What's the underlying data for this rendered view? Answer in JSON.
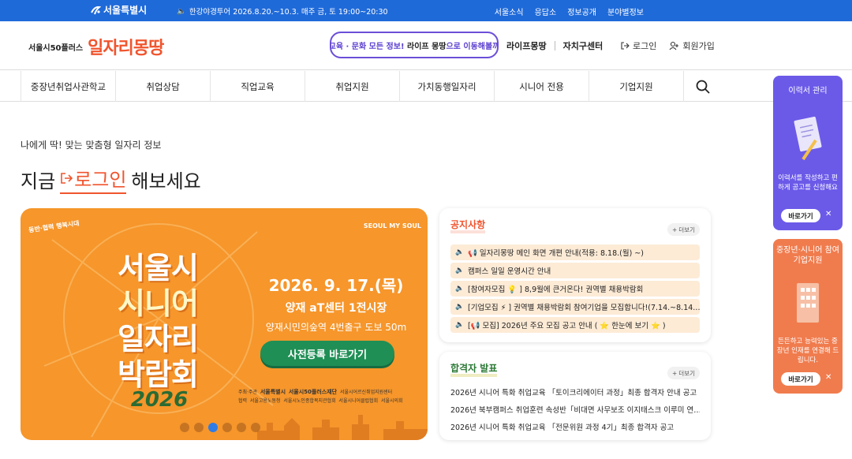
{
  "topbar": {
    "logo": "서울특별시",
    "notice": "한강야경투어 2026.8.20.~10.3. 매주 금, 토 19:00~20:30",
    "links": [
      "서울소식",
      "응답소",
      "정보공개",
      "분야별정보"
    ]
  },
  "header": {
    "brand_sub": "서울시50플러스",
    "brand_main": "일자리몽땅",
    "promo_a": "교육 · 문화 모든 정보!",
    "promo_b": "라이프 몽땅",
    "promo_c": "으로 이동해볼까",
    "nav": [
      "라이프몽땅",
      "자치구센터"
    ],
    "login": "로그인",
    "signup": "회원가입"
  },
  "gnb": [
    "중장년취업사관학교",
    "취업상담",
    "직업교육",
    "취업지원",
    "가치동행일자리",
    "시니어 전용",
    "기업지원"
  ],
  "intro": "나에게 딱! 맞는 맞춤형 일자리 정보",
  "headline": {
    "prefix": "지금",
    "login": "로그인",
    "suffix": "해보세요"
  },
  "banner": {
    "tag": "동반·협력 행복시대",
    "seoul": "SEOUL MY SOUL",
    "line1": "서울시",
    "line2": "시니어",
    "line3": "일자리",
    "line4": "박람회",
    "year": "2026",
    "date": "2026. 9. 17.(목)",
    "venue": "양재 aT센터 1전시장",
    "subway": "양재시민의숲역 4번출구 도보 50m",
    "cta": "사전등록 바로가기",
    "host_label": "주최·주관",
    "host_1": "서울특별시",
    "host_2": "서울시50플러스재단",
    "host_3": "서울시어르신취업지원센터",
    "sponsor_label": "협력",
    "sponsor_1": "서울고용노동청",
    "sponsor_2": "서울시노인종합복지관협회",
    "sponsor_3": "서울시니어클럽협회",
    "sponsor_4": "서울시의회"
  },
  "notice_card": {
    "title": "공지사항",
    "more": "더보기",
    "items": [
      "📢 일자리몽땅 메인 화면 개편 안내(적용: 8.18.(월) ~)",
      "캠퍼스 일일 운영시간 안내",
      "[참여자모집 💡 ] 8,9월에 큰거온다! 권역별 채용박람회",
      "[기업모집 ⚡ ] 권역별 채용박람회 참여기업을 모집합니다!(7.14.~8.14.…",
      "[📢 모집] 2026년 주요 모집 공고 안내 ( ⭐ 한눈에 보기 ⭐ )"
    ]
  },
  "pass_card": {
    "title": "합격자 발표",
    "more": "더보기",
    "items": [
      "2026년 시니어 특화 취업교육 「토이크리에이터 과정」최종 합격자 안내 공고",
      "2026년 북부캠퍼스 취업훈련 속성반「비대면 사무보조 이지태스크 이루미 연…",
      "2026년 시니어 특화 취업교육 「전문위원 과정 4기」최종 합격자 공고"
    ]
  },
  "quick": [
    {
      "title": "이력서 관리",
      "desc": "이력서를 작성하고 편하게 공고를 신청해요",
      "button": "바로가기"
    },
    {
      "title": "중장년·시니어 참여기업지원",
      "desc": "든든하고 능력있는 중장년 인재를 연결해 드립니다.",
      "button": "바로가기"
    }
  ],
  "colors": {
    "primary_blue": "#1f6ad9",
    "brand_orange": "#f0552e",
    "promo_purple": "#6b4ed8",
    "banner_orange": "#f6962b",
    "cta_green": "#1f8f55"
  },
  "carousel": {
    "total": 6,
    "active": 3
  }
}
